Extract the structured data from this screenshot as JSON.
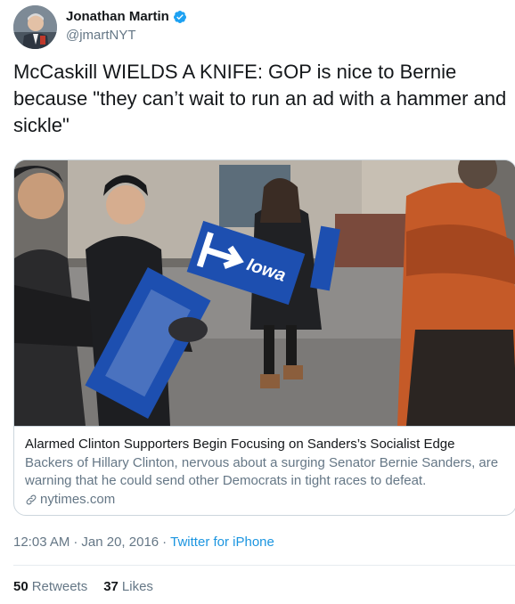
{
  "author": {
    "display_name": "Jonathan Martin",
    "handle": "@jmartNYT",
    "avatar_icon": "person-photo-icon",
    "verified_icon": "verified-badge-icon"
  },
  "tweet": {
    "text": "McCaskill WIELDS A KNIFE: GOP is nice to Bernie because \"they can’t wait to run an ad with a hammer and sickle\""
  },
  "card": {
    "image_sign_text": "Iowa",
    "title": "Alarmed Clinton Supporters Begin Focusing on Sanders’s Socialist Edge",
    "description": "Backers of Hillary Clinton, nervous about a surging Senator Bernie Sanders, are warning that he could send other Democrats in tight races to defeat.",
    "domain": "nytimes.com",
    "link_icon": "link-icon"
  },
  "meta": {
    "time": "12:03 AM",
    "separator": "·",
    "date": "Jan 20, 2016",
    "separator2": "·",
    "source": "Twitter for iPhone"
  },
  "stats": {
    "retweets_count": "50",
    "retweets_label": "Retweets",
    "likes_count": "37",
    "likes_label": "Likes"
  },
  "colors": {
    "link_blue": "#1b95e0",
    "secondary_text": "#657786",
    "border": "#ccd6dd"
  }
}
